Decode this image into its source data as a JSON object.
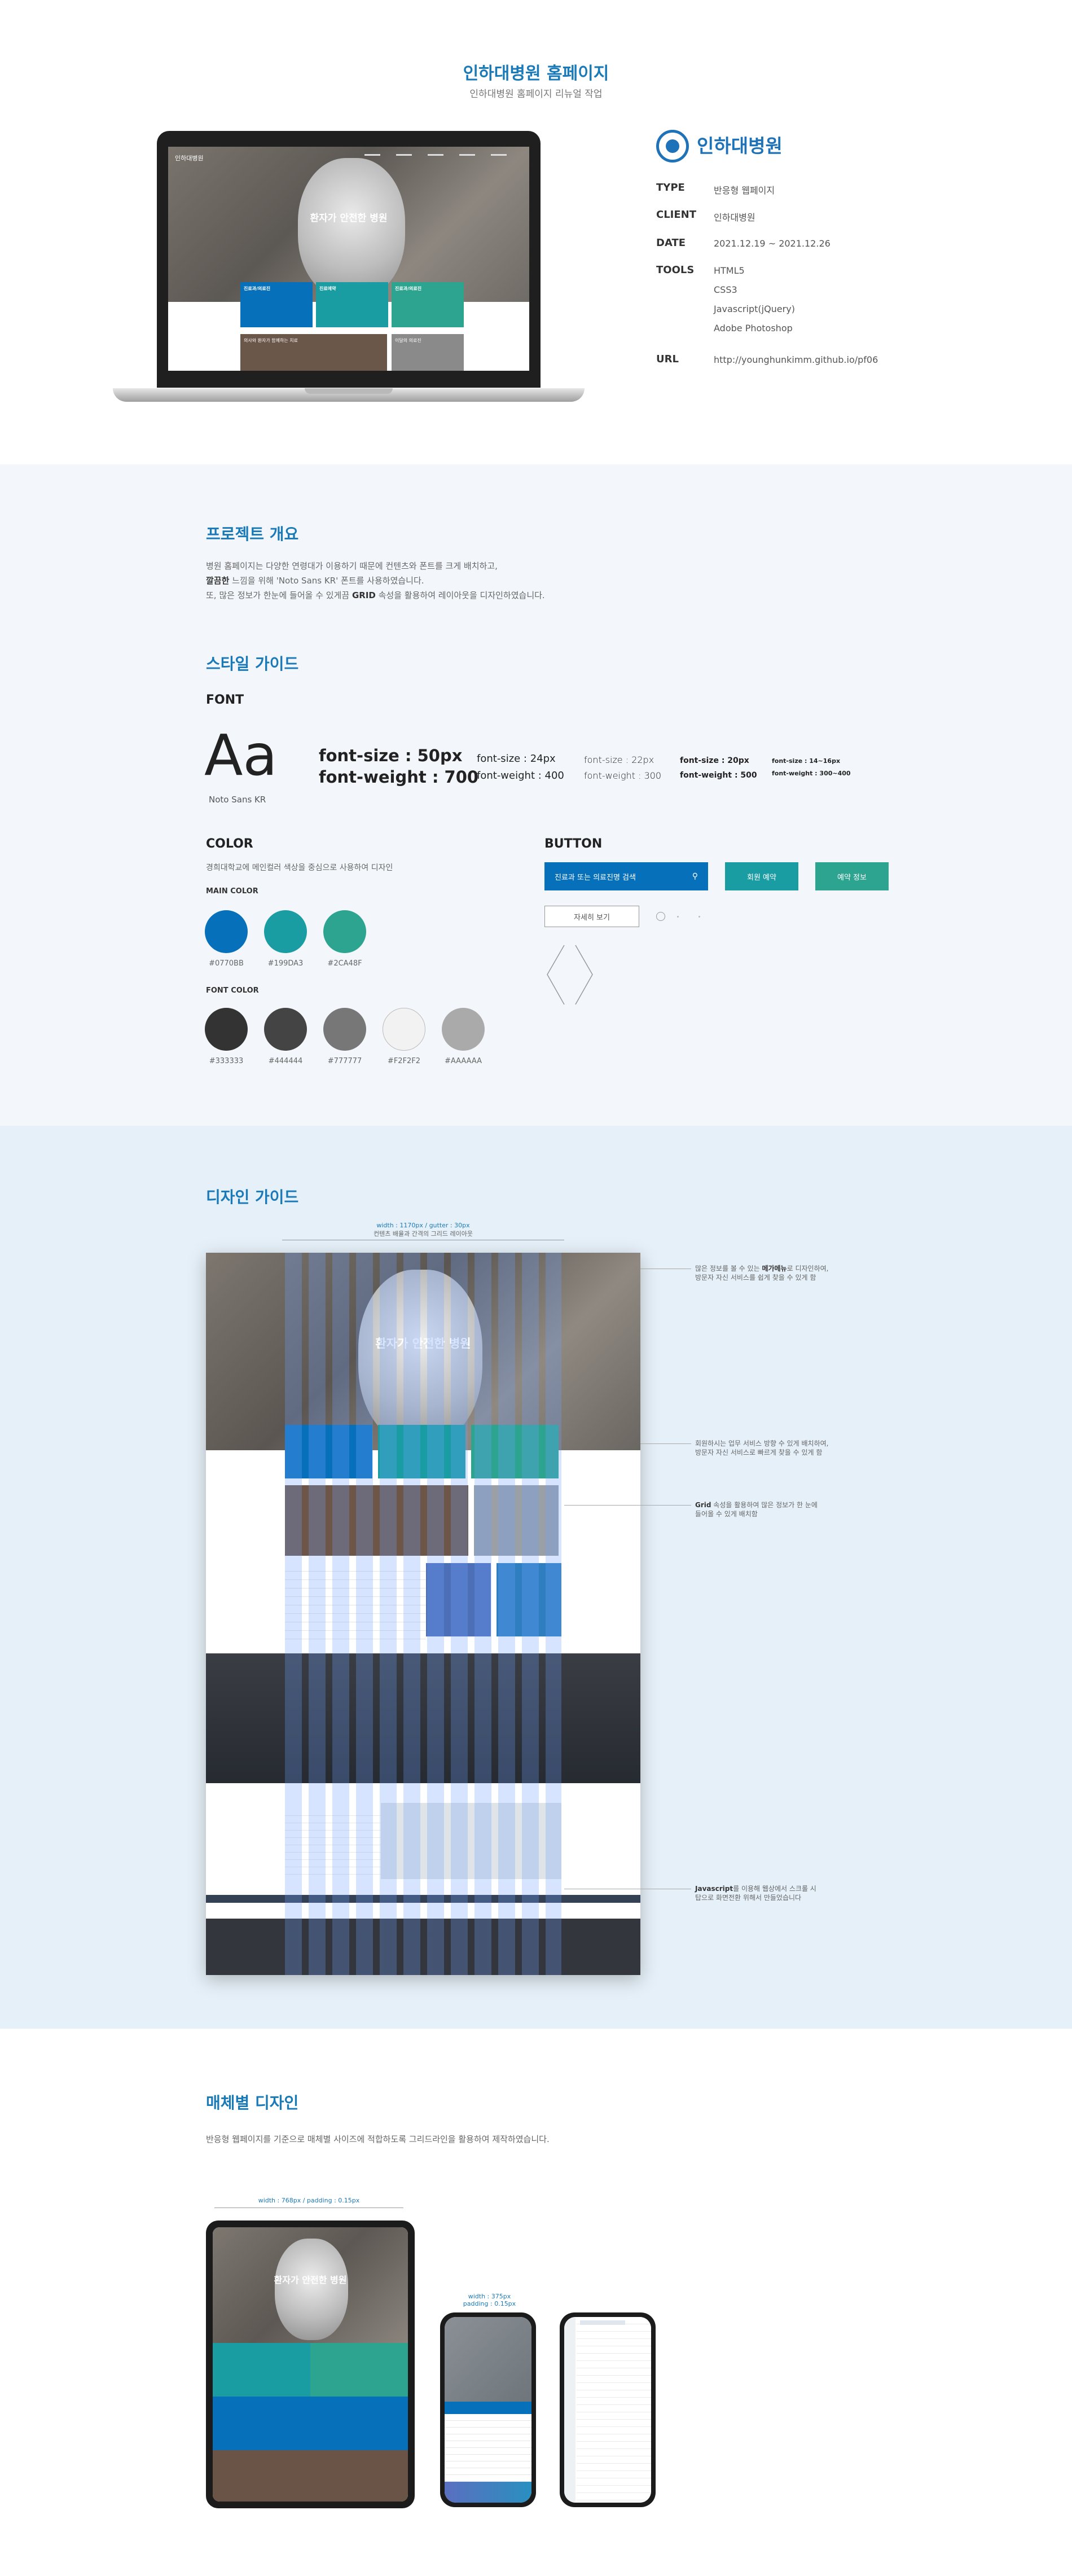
{
  "header": {
    "title": "인하대병원 홈페이지",
    "subtitle": "인하대병원 홈페이지 리뉴얼 작업"
  },
  "mockup": {
    "logo": "인하대병원",
    "hero_text": "환자가 안전한 병원",
    "cards": [
      "진료과/의료진",
      "진료예약",
      "진료과/의료진"
    ],
    "bottom_left": "의사와 환자가 함께하는 치료",
    "bottom_right": "이달의 의료진"
  },
  "info": {
    "logo_text": "인하대병원",
    "rows": [
      {
        "key": "TYPE",
        "value": "반응형 웹페이지"
      },
      {
        "key": "CLIENT",
        "value": "인하대병원"
      },
      {
        "key": "DATE",
        "value": "2021.12.19 ~ 2021.12.26"
      },
      {
        "key": "TOOLS",
        "value": [
          "HTML5",
          "CSS3",
          "Javascript(jQuery)",
          "Adobe Photoshop"
        ]
      },
      {
        "key": "URL",
        "value": "http://younghunkimm.github.io/pf06"
      }
    ]
  },
  "overview": {
    "title": "프로젝트 개요",
    "line1": "병원 홈페이지는 다양한 연령대가 이용하기 때문에 컨텐츠와 폰트를 크게 배치하고,",
    "line2_bold": "깔끔한",
    "line2": " 느낌을 위해 'Noto Sans KR' 폰트를 사용하였습니다.",
    "line3_pre": "또, 많은 정보가 한눈에 들어올 수 있게끔 ",
    "line3_bold": "GRID",
    "line3": " 속성을 활용하여 레이아웃을 디자인하였습니다."
  },
  "style_guide": {
    "title": "스타일 가이드",
    "font_label": "FONT",
    "sample": "Aa",
    "font_name": "Noto Sans KR",
    "sizes": [
      {
        "size": "font-size : 50px",
        "weight": "font-weight : 700"
      },
      {
        "size": "font-size : 24px",
        "weight": "font-weight : 400"
      },
      {
        "size": "font-size : 22px",
        "weight": "font-weight : 300"
      },
      {
        "size": "font-size : 20px",
        "weight": "font-weight : 500"
      },
      {
        "size": "font-size : 14~16px",
        "weight": "font-weight : 300~400"
      }
    ],
    "color_label": "COLOR",
    "color_desc": "경희대학교에 메인컬러 색상을 중심으로 사용하여 디자인",
    "main_color_label": "MAIN COLOR",
    "main_colors": [
      "#0770BB",
      "#199DA3",
      "#2CA48F"
    ],
    "font_color_label": "FONT COLOR",
    "font_colors": [
      "#333333",
      "#444444",
      "#777777",
      "#F2F2F2",
      "#AAAAAA"
    ],
    "button_label": "BUTTON",
    "search_placeholder": "진료과 또는 의료진명 검색",
    "btn_reserve": "회원 예약",
    "btn_info": "예약 정보",
    "btn_more": "자세히 보기"
  },
  "design_guide": {
    "title": "디자인 가이드",
    "dim_label": "width : 1170px / gutter : 30px",
    "dim_sub": "컨텐츠 배율과 간격의 그리드 레이아웃",
    "hero_text": "환자가 안전한 병원",
    "notes": [
      {
        "pre": "많은 정보를 볼 수 있는 ",
        "bold": "메가메뉴",
        "post": "로 디자인하여,",
        "line2": "방문자 자신 서비스를 쉽게 찾을 수 있게 함"
      },
      {
        "pre": "회원하시는 업무 서비스 방향 수 있게 배치하여,",
        "bold": "",
        "post": "",
        "line2": "방문자 자신 서비스로 빠르게 찾을 수 있게 함"
      },
      {
        "pre": "",
        "bold": "Grid",
        "post": " 속성을 활용하여 많은 정보가 한 눈에",
        "line2": "들어올 수 있게 배치함"
      },
      {
        "pre": "",
        "bold": "Javascript",
        "post": "를 이용해 웹상에서 스크롤 시",
        "line2": "탑으로 화면전환 위해서 만들었습니다"
      }
    ]
  },
  "responsive": {
    "title": "매체별 디자인",
    "desc": "반응형 웹페이지를 기준으로 매체별 사이즈에 적합하도록 그리드라인을 활용하여 제작하였습니다.",
    "tablet_dim": "width : 768px / padding : 0.15px",
    "mobile_dim": "width : 375px",
    "mobile_dim2": "padding : 0.15px",
    "tablet_hero": "환자가 안전한 병원"
  },
  "colors": {
    "accent": "#1a7ab8"
  }
}
